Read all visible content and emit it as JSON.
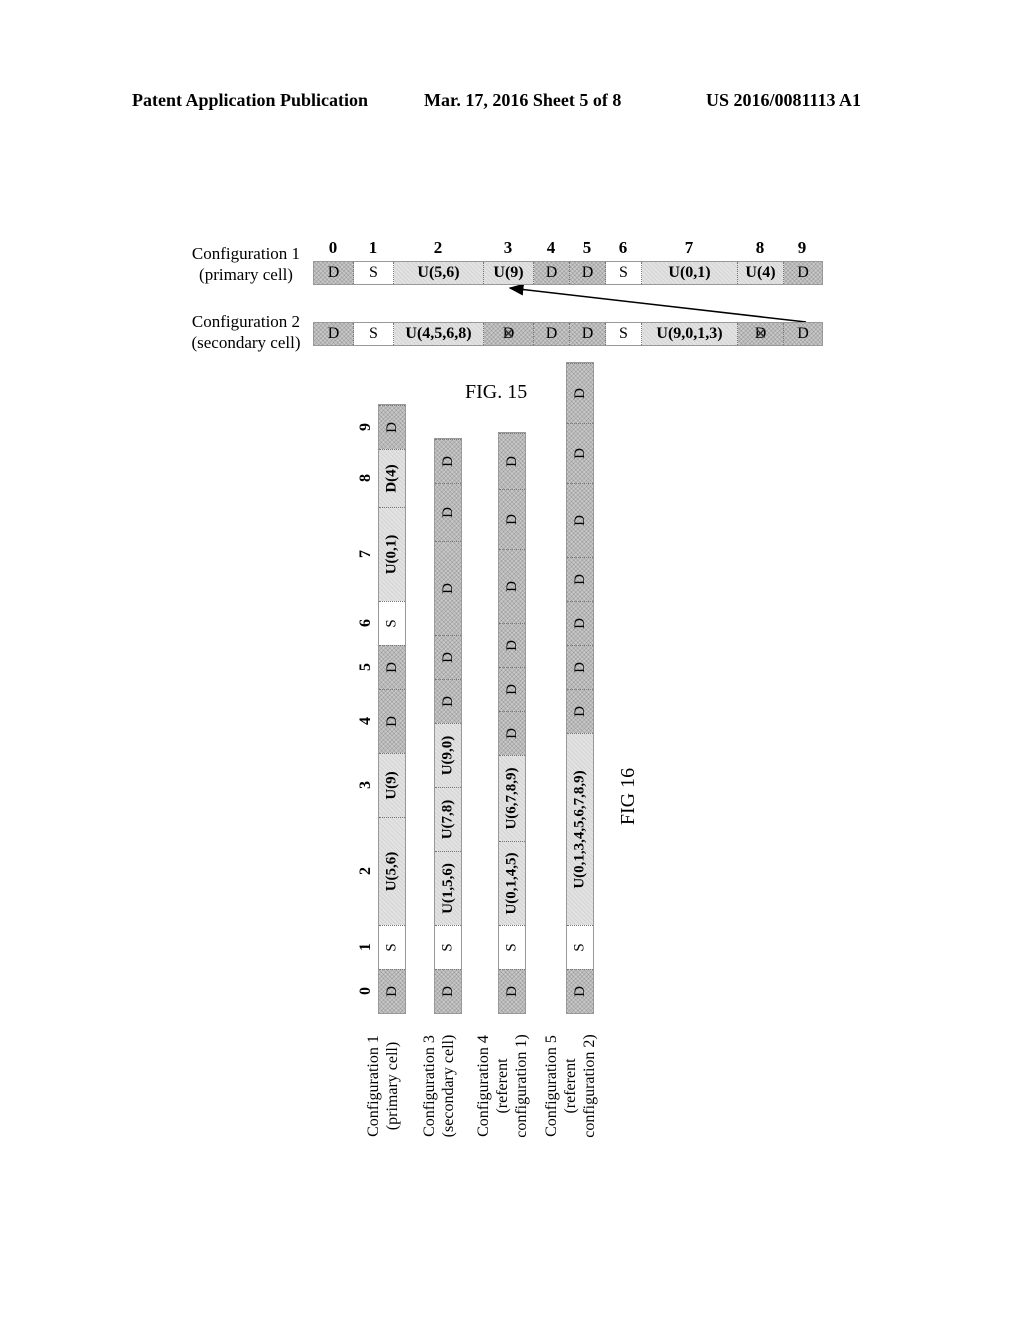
{
  "header": {
    "left": "Patent Application Publication",
    "center": "Mar. 17, 2016  Sheet 5 of 8",
    "right": "US 2016/0081113 A1"
  },
  "fig15": {
    "caption": "FIG. 15",
    "indices": [
      "0",
      "1",
      "2",
      "3",
      "4",
      "5",
      "6",
      "7",
      "8",
      "9"
    ],
    "rows": [
      {
        "label_line1": "Configuration 1",
        "label_line2": "(primary cell)",
        "cells": [
          {
            "text": "D",
            "type": "D"
          },
          {
            "text": "S",
            "type": "S"
          },
          {
            "text": "U(5,6)",
            "type": "U"
          },
          {
            "text": "U(9)",
            "type": "U"
          },
          {
            "text": "D",
            "type": "D"
          },
          {
            "text": "D",
            "type": "D"
          },
          {
            "text": "S",
            "type": "S"
          },
          {
            "text": "U(0,1)",
            "type": "U"
          },
          {
            "text": "U(4)",
            "type": "U"
          },
          {
            "text": "D",
            "type": "D"
          }
        ]
      },
      {
        "label_line1": "Configuration 2",
        "label_line2": "(secondary cell)",
        "cells": [
          {
            "text": "D",
            "type": "D"
          },
          {
            "text": "S",
            "type": "S"
          },
          {
            "text": "U(4,5,6,8)",
            "type": "U"
          },
          {
            "text": "D",
            "type": "D",
            "crossed": true
          },
          {
            "text": "D",
            "type": "D"
          },
          {
            "text": "D",
            "type": "D"
          },
          {
            "text": "S",
            "type": "S"
          },
          {
            "text": "U(9,0,1,3)",
            "type": "U"
          },
          {
            "text": "D",
            "type": "D",
            "crossed": true
          },
          {
            "text": "D",
            "type": "D"
          }
        ]
      }
    ],
    "arrow": {
      "from": "Configuration 2 subframe 9",
      "to": "Configuration 1 subframe 3"
    }
  },
  "fig16": {
    "caption": "FIG 16",
    "indices": [
      "0",
      "1",
      "2",
      "3",
      "4",
      "5",
      "6",
      "7",
      "8",
      "9"
    ],
    "rows": [
      {
        "label_lines": [
          "Configuration 1",
          "(primary cell)"
        ],
        "cells": [
          {
            "text": "D",
            "type": "D"
          },
          {
            "text": "S",
            "type": "S"
          },
          {
            "text": "U(5,6)",
            "type": "U"
          },
          {
            "text": "U(9)",
            "type": "U"
          },
          {
            "text": "D",
            "type": "D"
          },
          {
            "text": "D",
            "type": "D"
          },
          {
            "text": "S",
            "type": "S"
          },
          {
            "text": "U(0,1)",
            "type": "U"
          },
          {
            "text": "D(4)",
            "type": "U"
          },
          {
            "text": "D",
            "type": "D"
          }
        ]
      },
      {
        "label_lines": [
          "Configuration 3",
          "(secondary cell)"
        ],
        "cells": [
          {
            "text": "D",
            "type": "D"
          },
          {
            "text": "S",
            "type": "S"
          },
          {
            "text": "U(1,5,6)",
            "type": "U"
          },
          {
            "text": "U(7,8)",
            "type": "U"
          },
          {
            "text": "U(9,0)",
            "type": "U"
          },
          {
            "text": "D",
            "type": "D"
          },
          {
            "text": "D",
            "type": "D"
          },
          {
            "text": "D",
            "type": "D"
          },
          {
            "text": "D",
            "type": "D"
          },
          {
            "text": "D",
            "type": "D"
          }
        ]
      },
      {
        "label_lines": [
          "Configuration 4",
          "(referent",
          "configuration 1)"
        ],
        "cells": [
          {
            "text": "D",
            "type": "D"
          },
          {
            "text": "S",
            "type": "S"
          },
          {
            "text": "U(0,1,4,5)",
            "type": "U"
          },
          {
            "text": "U(6,7,8,9)",
            "type": "U"
          },
          {
            "text": "D",
            "type": "D"
          },
          {
            "text": "D",
            "type": "D"
          },
          {
            "text": "D",
            "type": "D"
          },
          {
            "text": "D",
            "type": "D"
          },
          {
            "text": "D",
            "type": "D"
          },
          {
            "text": "D",
            "type": "D"
          }
        ]
      },
      {
        "label_lines": [
          "Configuration 5",
          "(referent",
          "configuration 2)"
        ],
        "cells": [
          {
            "text": "D",
            "type": "D"
          },
          {
            "text": "S",
            "type": "S"
          },
          {
            "text": "U(0,1,3,4,5,6,7,8,9)",
            "type": "U"
          },
          {
            "text": "D",
            "type": "D"
          },
          {
            "text": "D",
            "type": "D"
          },
          {
            "text": "D",
            "type": "D"
          },
          {
            "text": "D",
            "type": "D"
          },
          {
            "text": "D",
            "type": "D"
          },
          {
            "text": "D",
            "type": "D"
          },
          {
            "text": "D",
            "type": "D"
          }
        ]
      }
    ]
  }
}
